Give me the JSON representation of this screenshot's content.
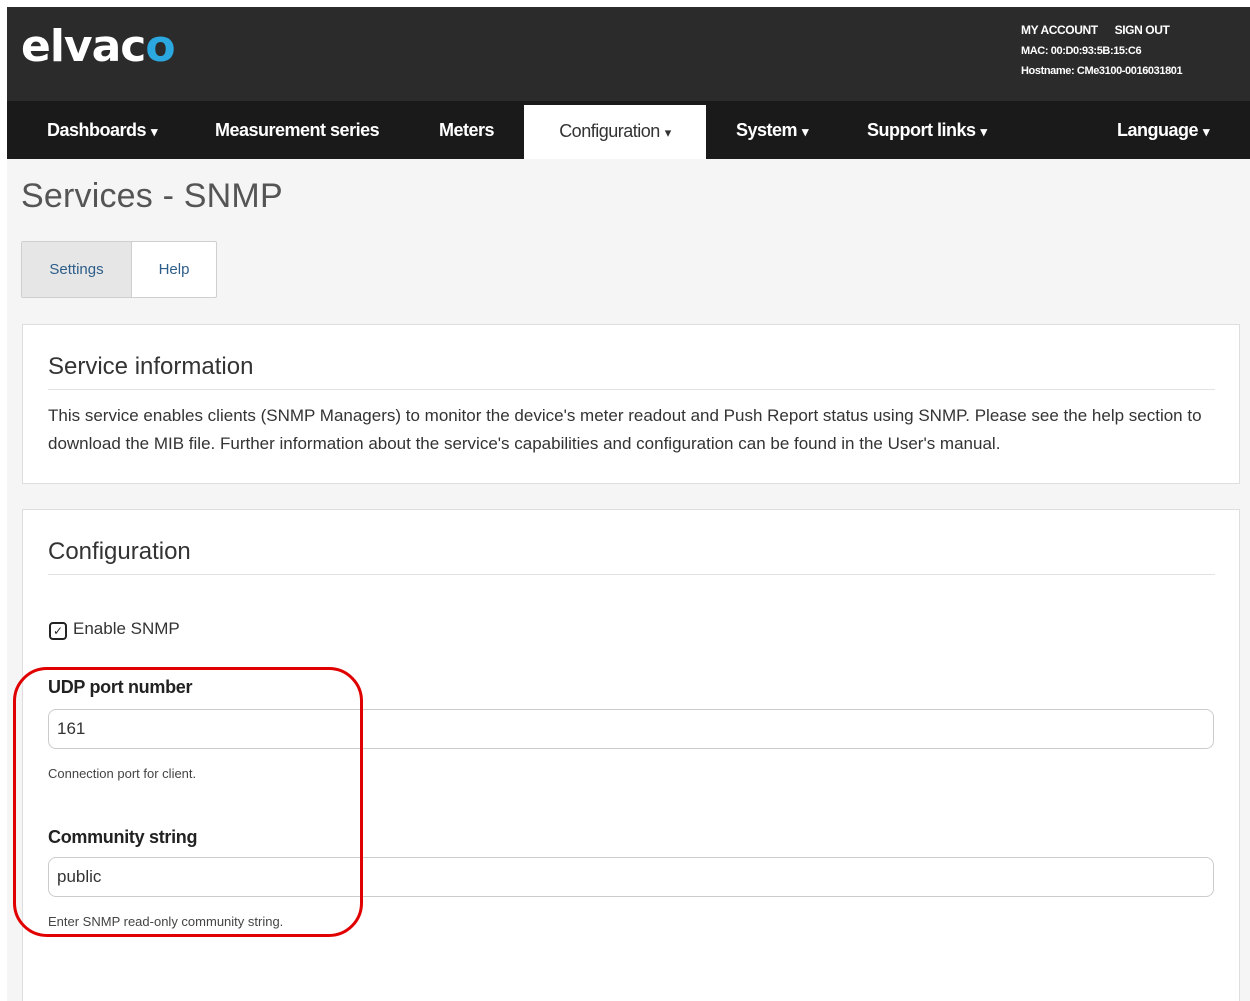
{
  "header": {
    "logo_main": "elvac",
    "logo_accent": "o",
    "my_account": "MY ACCOUNT",
    "sign_out": "SIGN OUT",
    "mac": "MAC: 00:D0:93:5B:15:C6",
    "hostname": "Hostname: CMe3100-0016031801"
  },
  "nav": {
    "dashboards": "Dashboards",
    "measurement_series": "Measurement series",
    "meters": "Meters",
    "configuration": "Configuration",
    "system": "System",
    "support_links": "Support links",
    "language": "Language"
  },
  "page": {
    "title": "Services - SNMP"
  },
  "tabs": {
    "settings": "Settings",
    "help": "Help"
  },
  "service_info": {
    "title": "Service information",
    "text": "This service enables clients (SNMP Managers) to monitor the device's meter readout and Push Report status using SNMP. Please see the help section to download the MIB file. Further information about the service's capabilities and configuration can be found in the User's manual."
  },
  "configuration": {
    "title": "Configuration",
    "enable_label": "Enable SNMP",
    "enable_checked": true,
    "udp_label": "UDP port number",
    "udp_value": "161",
    "udp_help": "Connection port for client.",
    "community_label": "Community string",
    "community_value": "public",
    "community_help": "Enter SNMP read-only community string."
  },
  "colors": {
    "accent": "#2aa8df",
    "highlight": "#e00000",
    "header": "#2b2b2b",
    "nav": "#1a1a1a"
  }
}
